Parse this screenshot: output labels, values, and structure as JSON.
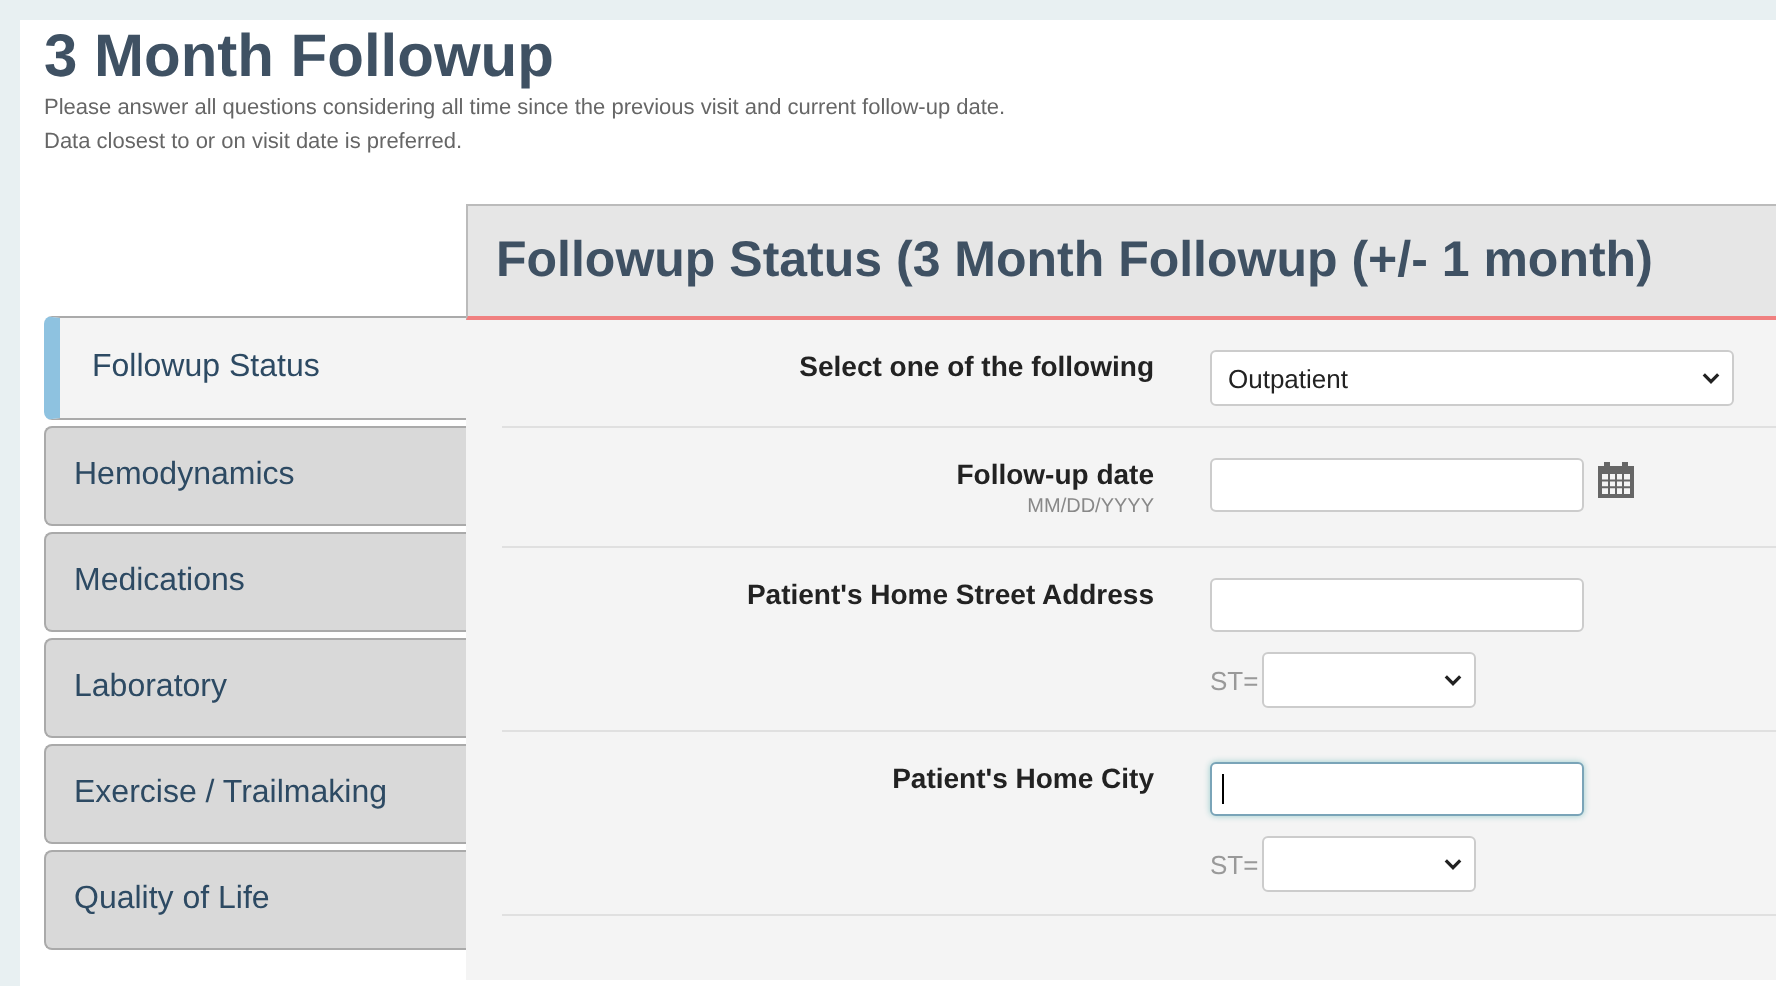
{
  "page": {
    "title": "3 Month Followup",
    "intro": [
      "Please answer all questions considering all time since the previous visit and current follow-up date.",
      "Data closest to or on visit date is preferred."
    ]
  },
  "tabs": [
    {
      "label": "Followup Status",
      "selected": true
    },
    {
      "label": "Hemodynamics",
      "selected": false
    },
    {
      "label": "Medications",
      "selected": false
    },
    {
      "label": "Laboratory",
      "selected": false
    },
    {
      "label": "Exercise / Trailmaking",
      "selected": false
    },
    {
      "label": "Quality of Life",
      "selected": false
    }
  ],
  "section": {
    "title": "Followup Status (3 Month Followup (+/- 1 month)",
    "rows": [
      {
        "kind": "select",
        "label": "Select one of the following",
        "value": "Outpatient"
      },
      {
        "kind": "date",
        "label": "Follow-up date",
        "hint": "MM/DD/YYYY"
      },
      {
        "kind": "address",
        "label": "Patient's Home Street Address",
        "state_label": "ST=",
        "focused": false
      },
      {
        "kind": "address",
        "label": "Patient's Home City",
        "state_label": "ST=",
        "focused": true
      }
    ]
  }
}
